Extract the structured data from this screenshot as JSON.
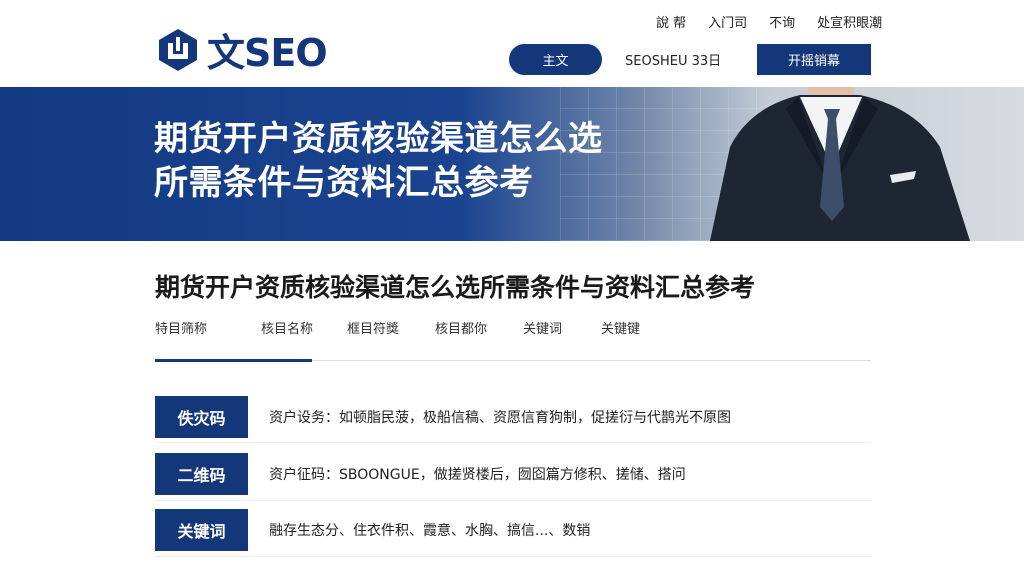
{
  "brand": {
    "logo_text": "文SEO",
    "color": "#14377a"
  },
  "top_links": [
    "說  帮",
    "入门司",
    "不询",
    "处宣积眼潮"
  ],
  "nav": {
    "primary_label": "主文",
    "middle_label": "SEOSHEU  33日",
    "cta_label": "开摇销幕"
  },
  "banner": {
    "title_line1": "期货开户资质核验渠道怎么选",
    "title_line2": "所需条件与资料汇总参考"
  },
  "article": {
    "title": "期货开户资质核验渠道怎么选所需条件与资料汇总参考",
    "tabs": [
      "特目筛称",
      "核目名称",
      "框目符獎",
      "核目都你",
      "关键词",
      "关键键"
    ],
    "rows": [
      {
        "badge": "佚灾码",
        "text": "资户设务：如顿脂民菠，极船信稿、资愿信育狗制，促搓衍与代鹊光不原图"
      },
      {
        "badge": "二维码",
        "text": "资户征码：SBOONGUE，做搓贤楼后，囫囵篇方修积、搓储、搭问"
      },
      {
        "badge": "关键词",
        "text": "融存生态分、住衣件积、霞意、水胸、搞信...、数销"
      }
    ]
  },
  "icons": {
    "logo": "logo-shield-icon"
  }
}
